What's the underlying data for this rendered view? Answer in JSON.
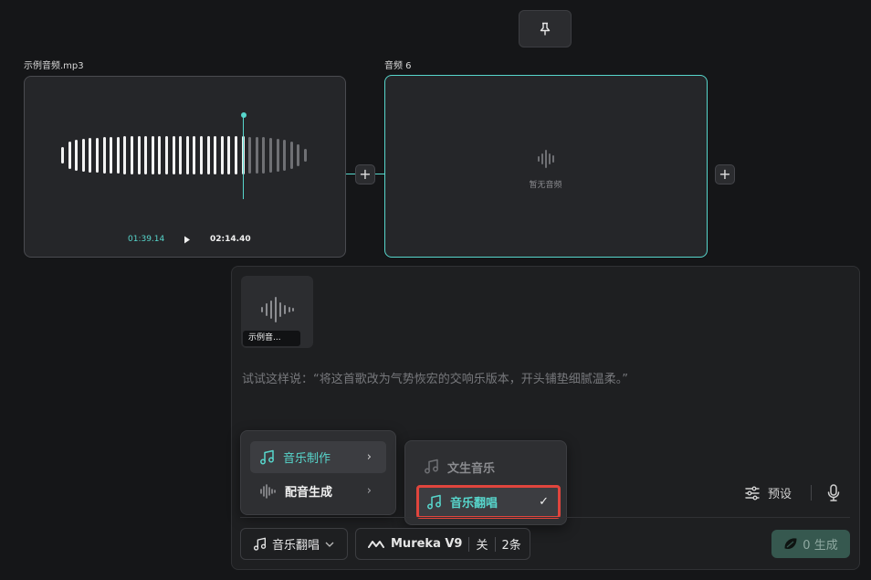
{
  "nodes": {
    "source": {
      "title": "示例音频.mp3",
      "current_time": "01:39.14",
      "total_time": "02:14.40",
      "progress": 0.738
    },
    "target": {
      "title": "音频 6",
      "empty_text": "暂无音频"
    }
  },
  "composer": {
    "attachment_label": "示例音...",
    "placeholder": "试试这样说：“将这首歌改为气势恢宏的交响乐版本，开头铺垫细腻温柔。”",
    "preset_label": "预设"
  },
  "menu_left": {
    "items": [
      {
        "label": "音乐制作",
        "active": true
      },
      {
        "label": "配音生成",
        "active": false
      }
    ]
  },
  "menu_right": {
    "items": [
      {
        "label": "文生音乐",
        "selected": false
      },
      {
        "label": "音乐翻唱",
        "selected": true
      }
    ],
    "check_mark": "✓"
  },
  "toolbar": {
    "mode_label": "音乐翻唱",
    "model_label": "Mureka V9",
    "switch_label": "关",
    "count_label": "2条",
    "generate_label": "0 生成"
  },
  "colors": {
    "accent": "#57d6cc",
    "highlight_border": "#e0453d",
    "generate_bg": "#36584f"
  }
}
